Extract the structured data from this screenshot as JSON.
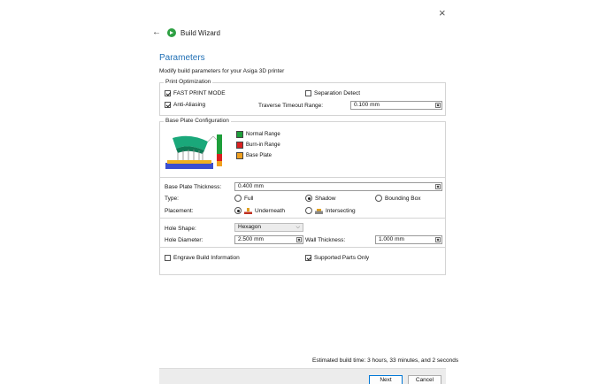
{
  "window": {
    "close_glyph": "×"
  },
  "header": {
    "back_glyph": "←",
    "title": "Build Wizard",
    "icon": "play-circle-icon",
    "icon_color": "#2ea043"
  },
  "page": {
    "heading": "Parameters",
    "description": "Modify build parameters for your Asiga 3D printer",
    "heading_color": "#1f6fb5"
  },
  "print_optimization": {
    "title": "Print Optimization",
    "fast_print_mode": {
      "label": "FAST PRINT MODE",
      "checked": true
    },
    "separation_detect": {
      "label": "Separation Detect",
      "checked": false
    },
    "anti_aliasing": {
      "label": "Anti-Aliasing",
      "checked": true
    },
    "traverse_timeout": {
      "label": "Traverse Timeout Range:",
      "value": "0.100 mm"
    }
  },
  "base_plate": {
    "title": "Base Plate Configuration",
    "legend": [
      {
        "label": "Normal Range",
        "color": "#1e9e3a"
      },
      {
        "label": "Burn-in Range",
        "color": "#d92020"
      },
      {
        "label": "Base Plate",
        "color": "#f0a020"
      }
    ],
    "thickness": {
      "label": "Base Plate Thickness:",
      "value": "0.400 mm"
    },
    "type": {
      "label": "Type:",
      "options": [
        {
          "label": "Full",
          "checked": false
        },
        {
          "label": "Shadow",
          "checked": true
        },
        {
          "label": "Bounding Box",
          "checked": false
        }
      ]
    },
    "placement": {
      "label": "Placement:",
      "options": [
        {
          "label": "Underneath",
          "checked": true
        },
        {
          "label": "Intersecting",
          "checked": false
        }
      ]
    },
    "hole_shape": {
      "label": "Hole Shape:",
      "value": "Hexagon"
    },
    "hole_diameter": {
      "label": "Hole Diameter:",
      "value": "2.500 mm"
    },
    "wall_thickness": {
      "label": "Wall Thickness:",
      "value": "1.000 mm"
    },
    "engrave": {
      "label": "Engrave Build Information",
      "checked": false
    },
    "supported_only": {
      "label": "Supported Parts Only",
      "checked": true
    }
  },
  "estimate": "Estimated build time: 3 hours, 33 minutes, and 2 seconds",
  "footer": {
    "next_label": "Next",
    "cancel_label": "Cancel",
    "primary_border": "#0078d7"
  }
}
